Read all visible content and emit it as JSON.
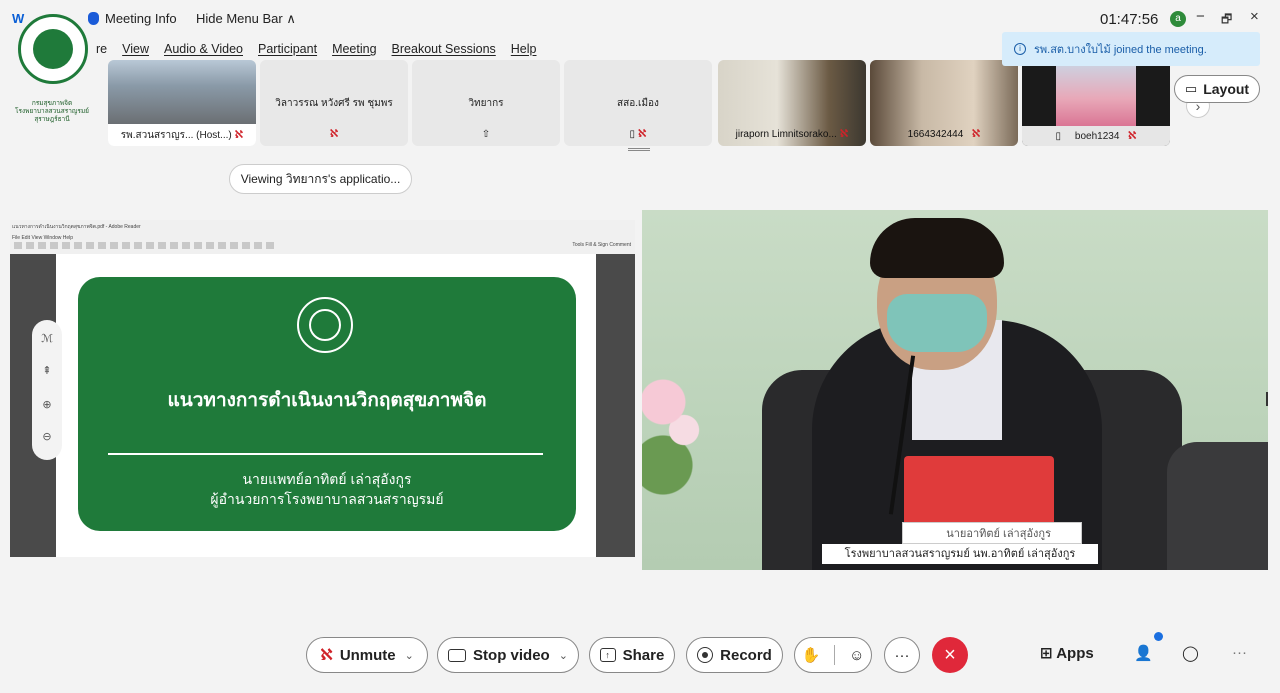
{
  "titlebar": {
    "app": "W",
    "meeting_info": "Meeting Info",
    "hide_menu": "Hide Menu Bar",
    "hide_menu_chev": "∧",
    "time": "01:47:56",
    "status_letter": "a",
    "minimize": "−",
    "restore": "🗗",
    "close": "×"
  },
  "menubar": {
    "items": [
      "re",
      "View",
      "Audio & Video",
      "Participant",
      "Meeting",
      "Breakout Sessions",
      "Help"
    ]
  },
  "logo": {
    "text_line1": "กรมสุขภาพจิต",
    "text_line2": "โรงพยาบาลสวนสราญรมย์",
    "text_line3": "สุราษฎร์ธานี"
  },
  "participants": [
    {
      "name": "รพ.สวนสราญร... (Host...)",
      "kind": "video"
    },
    {
      "name": "วิลาวรรณ หวังศรี รพ ชุมพร",
      "kind": "text"
    },
    {
      "name": "วิทยากร",
      "kind": "text"
    },
    {
      "name": "สสอ.เมือง",
      "kind": "text"
    },
    {
      "name": "jiraporn Limnitsorako...",
      "kind": "video"
    },
    {
      "name": "1664342444",
      "kind": "video"
    },
    {
      "name": "boeh1234",
      "kind": "video"
    }
  ],
  "notification": {
    "text": "รพ.สต.บางใบไม้ joined the meeting."
  },
  "layout_button": {
    "label": "Layout"
  },
  "viewing": {
    "text": "Viewing วิทยากร's applicatio..."
  },
  "shared": {
    "slide_title": "แนวทางการดำเนินงานวิกฤตสุขภาพจิต",
    "slide_sub1": "นายแพทย์อาทิตย์  เล่าสุอังกูร",
    "slide_sub2": "ผู้อำนวยการโรงพยาบาลสวนสราญรมย์",
    "window_title": "แนวทางการดำเนินงานวิกฤตสุขภาพจิต.pdf - Adobe Reader",
    "menu_text": "File  Edit  View  Window  Help",
    "tools_text": "Tools   Fill & Sign   Comment"
  },
  "video": {
    "nameplate": "นายอาทิตย์  เล่าสุอังกูร",
    "caption": "โรงพยาบาลสวนสราญรมย์ นพ.อาทิตย์ เล่าสุอังกูร"
  },
  "controls": {
    "unmute": "Unmute",
    "stop_video": "Stop video",
    "share": "Share",
    "record": "Record",
    "more": "···",
    "apps": "Apps",
    "overflow": "···"
  },
  "colors": {
    "slide_green": "#1f7a3a",
    "end_red": "#e0283a",
    "notif_bg": "#d6ecfb"
  }
}
